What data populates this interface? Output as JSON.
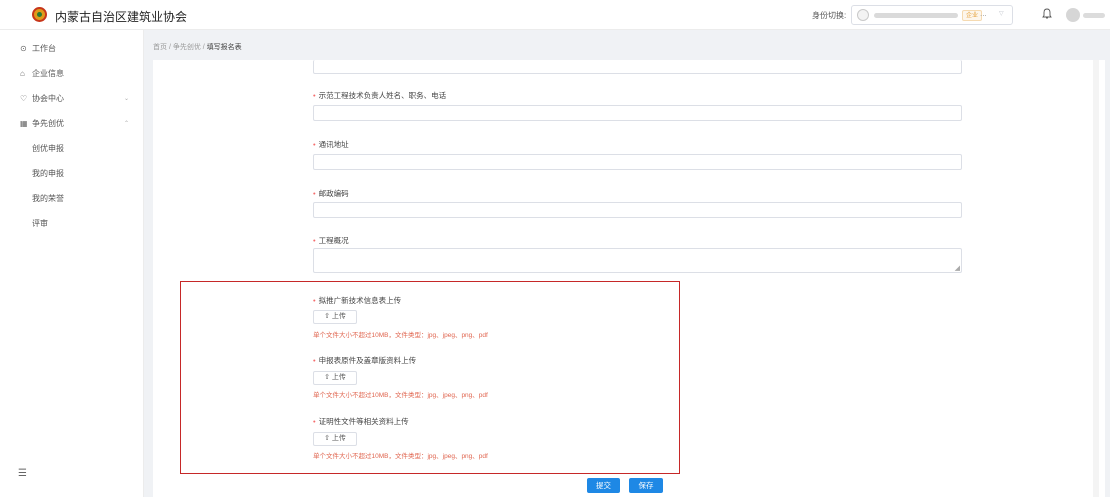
{
  "header": {
    "title": "内蒙古自治区建筑业协会",
    "role_switch_label": "身份切换:",
    "role_tag": "企业",
    "role_ellipsis": "...",
    "bell_icon": "bell-icon"
  },
  "sidebar": {
    "items": [
      {
        "label": "工作台",
        "icon": "clock-icon"
      },
      {
        "label": "企业信息",
        "icon": "home-icon"
      },
      {
        "label": "协会中心",
        "icon": "shield-icon"
      },
      {
        "label": "争先创优",
        "icon": "grid-icon"
      }
    ],
    "sub_items": [
      "创优申报",
      "我的申报",
      "我的荣誉",
      "评审"
    ]
  },
  "breadcrumb": {
    "home": "首页",
    "section": "争先创优",
    "current": "填写报名表",
    "sep": "/"
  },
  "form": {
    "fields": [
      {
        "label": "示范工程技术负责人姓名、职务、电话"
      },
      {
        "label": "通讯地址"
      },
      {
        "label": "邮政编码"
      },
      {
        "label": "工程概况"
      }
    ],
    "uploads": [
      {
        "label": "拟推广新技术信息表上传",
        "button": "上传",
        "hint": "单个文件大小不超过10MB，文件类型：jpg、jpeg、png、pdf"
      },
      {
        "label": "申报表原件及盖章版资料上传",
        "button": "上传",
        "hint": "单个文件大小不超过10MB，文件类型：jpg、jpeg、png、pdf"
      },
      {
        "label": "证明性文件等相关资料上传",
        "button": "上传",
        "hint": "单个文件大小不超过10MB，文件类型：jpg、jpeg、png、pdf"
      }
    ],
    "required_mark": "•"
  },
  "actions": {
    "submit": "提交",
    "save": "保存"
  },
  "colors": {
    "accent": "#1e88e5",
    "required": "#f56c6c",
    "hint": "#e0654f",
    "highlight": "#c62828"
  }
}
